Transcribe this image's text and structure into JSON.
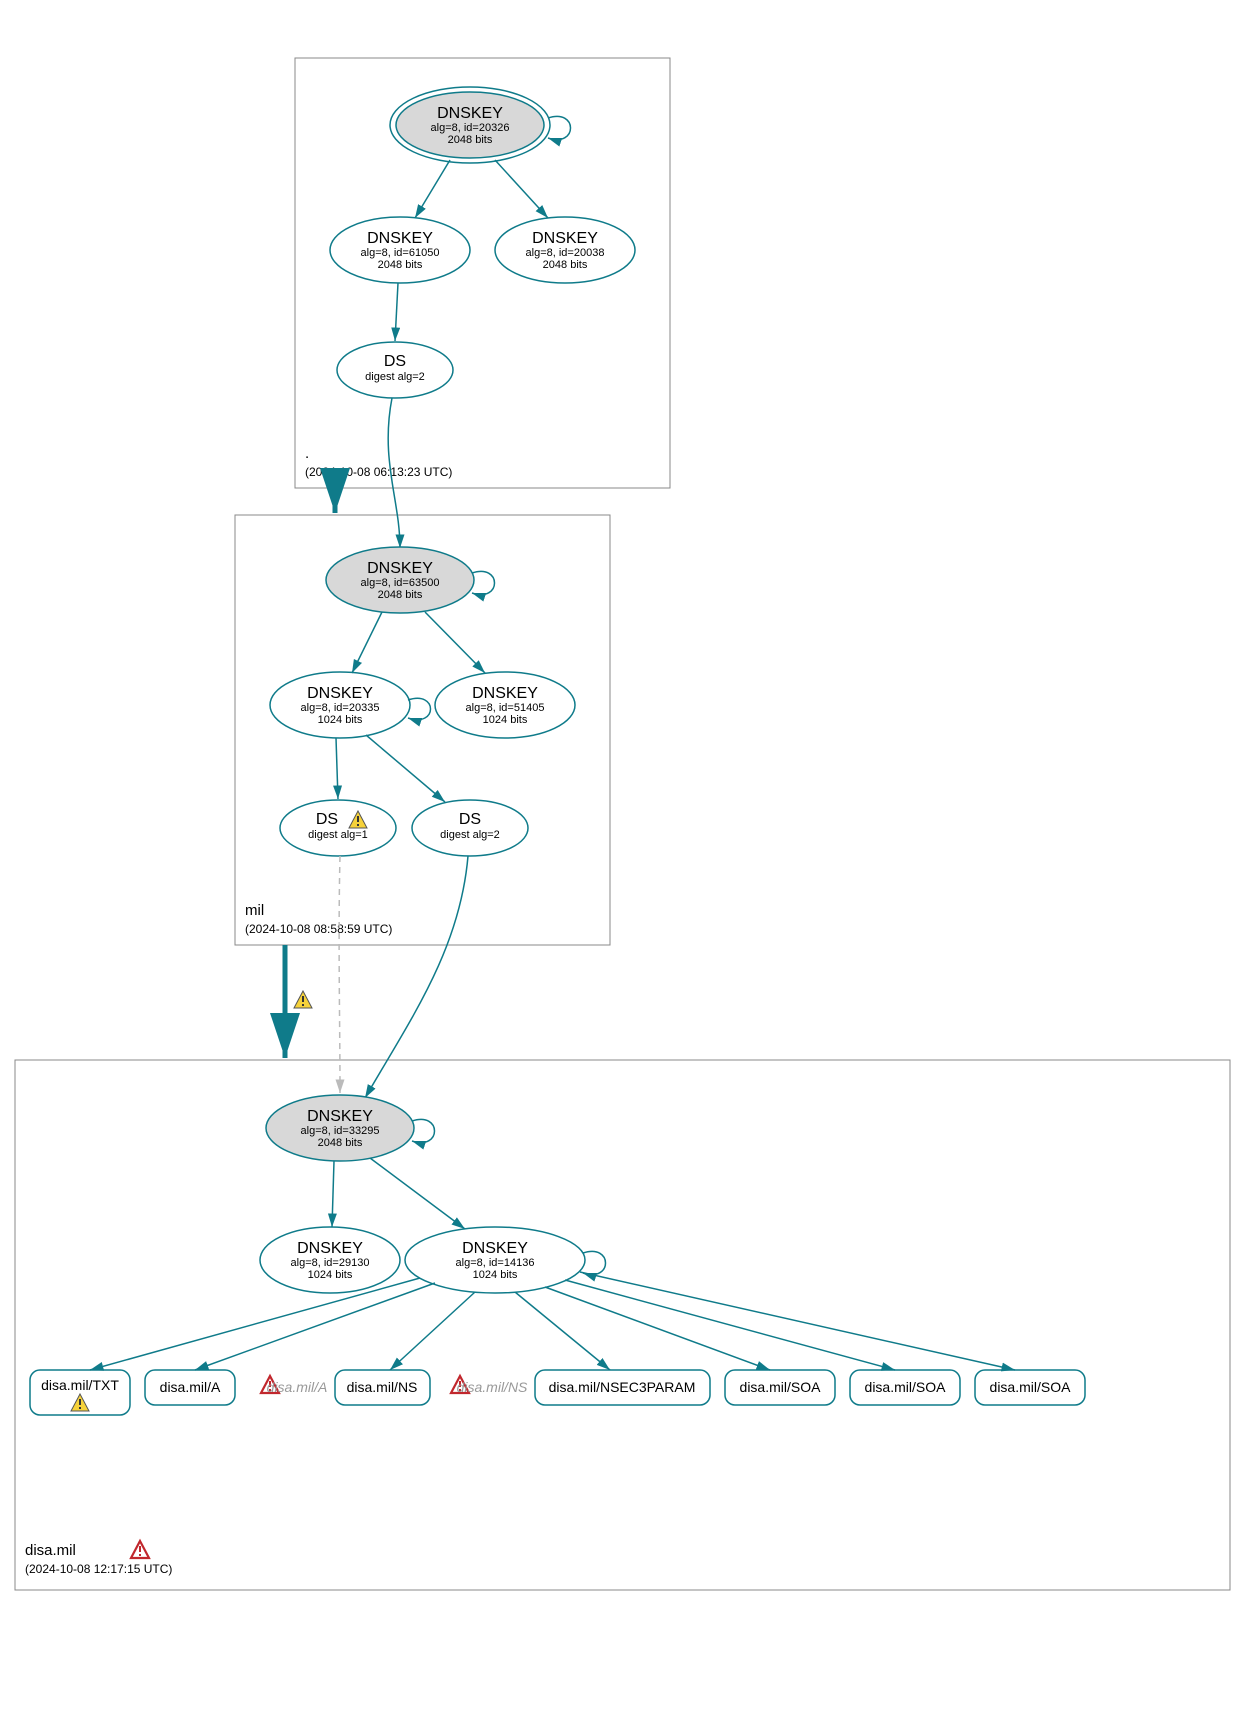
{
  "zones": {
    "root": {
      "label": ".",
      "timestamp": "(2024-10-08 06:13:23 UTC)"
    },
    "mil": {
      "label": "mil",
      "timestamp": "(2024-10-08 08:58:59 UTC)"
    },
    "disa": {
      "label": "disa.mil",
      "timestamp": "(2024-10-08 12:17:15 UTC)"
    }
  },
  "nodes": {
    "root_ksk": {
      "title": "DNSKEY",
      "l1": "alg=8, id=20326",
      "l2": "2048 bits"
    },
    "root_zsk1": {
      "title": "DNSKEY",
      "l1": "alg=8, id=61050",
      "l2": "2048 bits"
    },
    "root_zsk2": {
      "title": "DNSKEY",
      "l1": "alg=8, id=20038",
      "l2": "2048 bits"
    },
    "root_ds": {
      "title": "DS",
      "l1": "digest alg=2",
      "l2": ""
    },
    "mil_ksk": {
      "title": "DNSKEY",
      "l1": "alg=8, id=63500",
      "l2": "2048 bits"
    },
    "mil_zsk1": {
      "title": "DNSKEY",
      "l1": "alg=8, id=20335",
      "l2": "1024 bits"
    },
    "mil_zsk2": {
      "title": "DNSKEY",
      "l1": "alg=8, id=51405",
      "l2": "1024 bits"
    },
    "mil_ds1": {
      "title": "DS",
      "l1": "digest alg=1",
      "l2": ""
    },
    "mil_ds2": {
      "title": "DS",
      "l1": "digest alg=2",
      "l2": ""
    },
    "disa_ksk": {
      "title": "DNSKEY",
      "l1": "alg=8, id=33295",
      "l2": "2048 bits"
    },
    "disa_zsk1": {
      "title": "DNSKEY",
      "l1": "alg=8, id=29130",
      "l2": "1024 bits"
    },
    "disa_zsk2": {
      "title": "DNSKEY",
      "l1": "alg=8, id=14136",
      "l2": "1024 bits"
    }
  },
  "rr": {
    "txt": "disa.mil/TXT",
    "a": "disa.mil/A",
    "a_faded": "disa.mil/A",
    "ns": "disa.mil/NS",
    "ns_faded": "disa.mil/NS",
    "nsec3": "disa.mil/NSEC3PARAM",
    "soa1": "disa.mil/SOA",
    "soa2": "disa.mil/SOA",
    "soa3": "disa.mil/SOA"
  }
}
